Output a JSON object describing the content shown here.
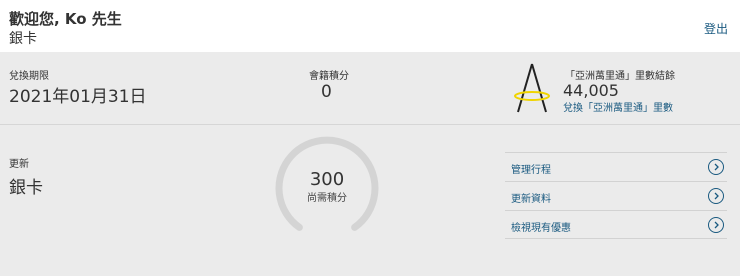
{
  "header": {
    "greeting": "歡迎您, Ko 先生",
    "tier": "銀卡",
    "logout": "登出"
  },
  "stats": {
    "expiry_label": "兌換期限",
    "expiry_value": "2021年01月31日",
    "points_label": "會籍積分",
    "points_value": "0",
    "miles_label": "「亞洲萬里通」里數結餘",
    "miles_value": "44,005",
    "miles_link": "兌換「亞洲萬里通」里數"
  },
  "renewal": {
    "label": "更新",
    "tier": "銀卡",
    "points_needed": "300",
    "points_needed_label": "尚需積分",
    "progress": 0
  },
  "links": [
    {
      "label": "管理行程"
    },
    {
      "label": "更新資料"
    },
    {
      "label": "檢視現有優惠"
    }
  ],
  "colors": {
    "accent": "#1a5a80",
    "ring": "#d4d4d4",
    "logo_ring": "#f0d400"
  }
}
